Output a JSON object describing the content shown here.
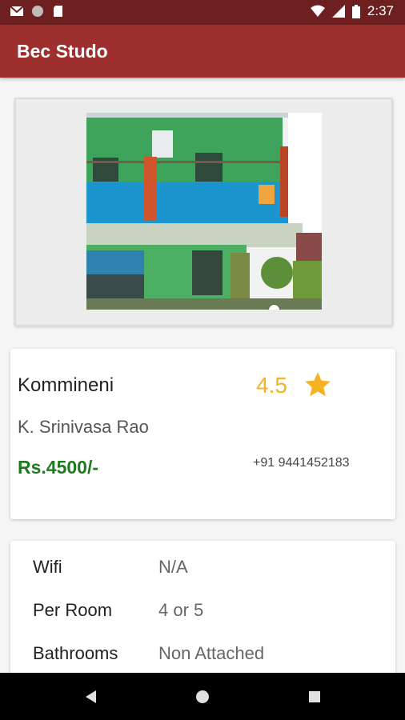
{
  "status_bar": {
    "time": "2:37",
    "icons": [
      "gmail-icon",
      "circle-icon",
      "sd-card-icon",
      "wifi-icon",
      "signal-icon",
      "battery-icon"
    ]
  },
  "app_bar": {
    "title": "Bec Studo"
  },
  "listing": {
    "name": "Kommineni",
    "rating": "4.5",
    "owner": "K. Srinivasa Rao",
    "price": "Rs.4500/-",
    "phone": "+91 9441452183"
  },
  "details": [
    {
      "label": "Wifi",
      "value": "N/A"
    },
    {
      "label": "Per Room",
      "value": "4 or 5"
    },
    {
      "label": "Bathrooms",
      "value": "Non Attached"
    }
  ],
  "image_pager": {
    "current_page": 1,
    "total_pages": 1
  },
  "colors": {
    "status_bar": "#6e1f1f",
    "app_bar": "#9e2f2f",
    "rating": "#f5b324",
    "price": "#1e7a1e"
  },
  "nav_bar": {
    "icons": [
      "back-icon",
      "home-icon",
      "recents-icon"
    ]
  }
}
